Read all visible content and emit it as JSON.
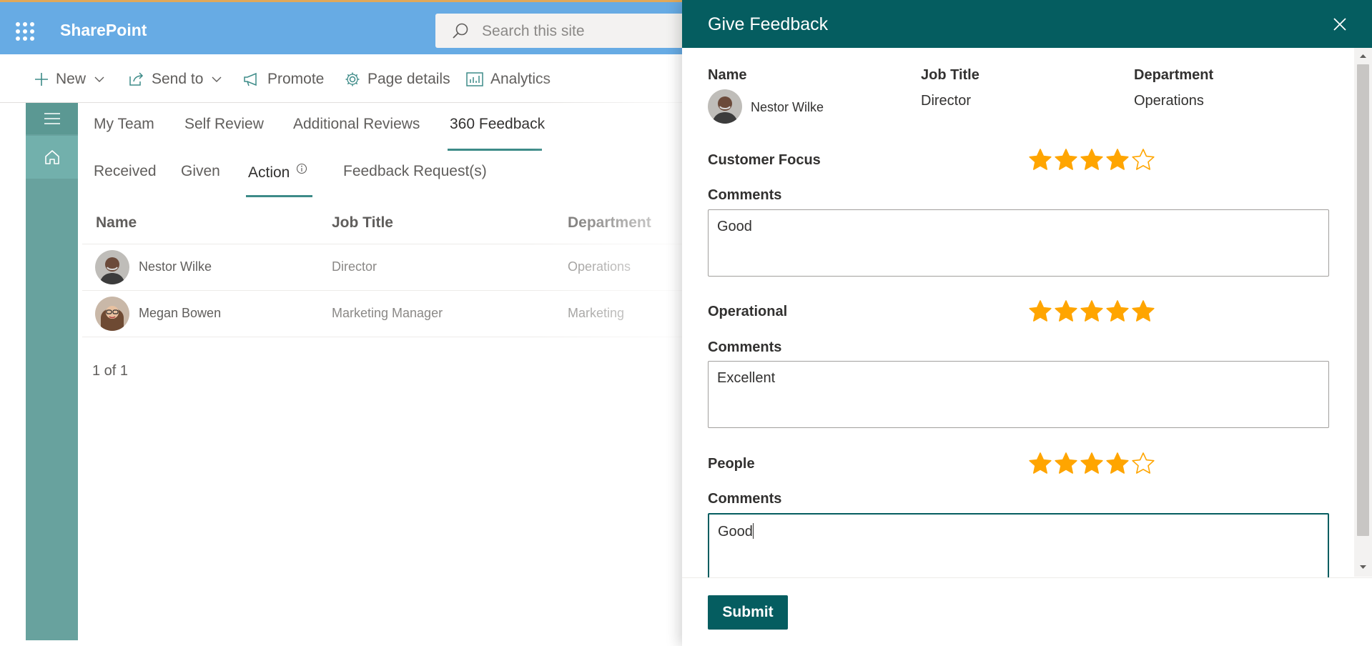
{
  "suitebar": {
    "brand": "SharePoint",
    "search_placeholder": "Search this site",
    "icons": [
      "waffle-icon",
      "search-icon"
    ],
    "color": "#67abe4"
  },
  "commandbar": {
    "new_label": "New",
    "send_to_label": "Send to",
    "promote_label": "Promote",
    "page_details_label": "Page details",
    "analytics_label": "Analytics"
  },
  "tabs": {
    "my_team": "My Team",
    "self_review": "Self Review",
    "additional_reviews": "Additional Reviews",
    "feedback_360": "360 Feedback",
    "active": "360 Feedback"
  },
  "subtabs": {
    "received": "Received",
    "given": "Given",
    "action": "Action",
    "feedback_requests": "Feedback Request(s)",
    "active": "Action"
  },
  "table": {
    "headers": {
      "name": "Name",
      "job_title": "Job Title",
      "department": "Department"
    },
    "rows": [
      {
        "name": "Nestor Wilke",
        "job_title": "Director",
        "department": "Operations"
      },
      {
        "name": "Megan Bowen",
        "job_title": "Marketing Manager",
        "department": "Marketing"
      }
    ],
    "pager": "1 of 1"
  },
  "panel": {
    "title": "Give Feedback",
    "accent": "#055d60",
    "star_color": "#ffa500",
    "employee": {
      "name_label": "Name",
      "name": "Nestor Wilke",
      "job_title_label": "Job Title",
      "job_title": "Director",
      "department_label": "Department",
      "department": "Operations"
    },
    "criteria": [
      {
        "label": "Customer Focus",
        "rating": 4,
        "max": 5,
        "comments_label": "Comments",
        "comment": "Good"
      },
      {
        "label": "Operational",
        "rating": 5,
        "max": 5,
        "comments_label": "Comments",
        "comment": "Excellent"
      },
      {
        "label": "People",
        "rating": 4,
        "max": 5,
        "comments_label": "Comments",
        "comment": "Good"
      }
    ],
    "submit_label": "Submit"
  }
}
